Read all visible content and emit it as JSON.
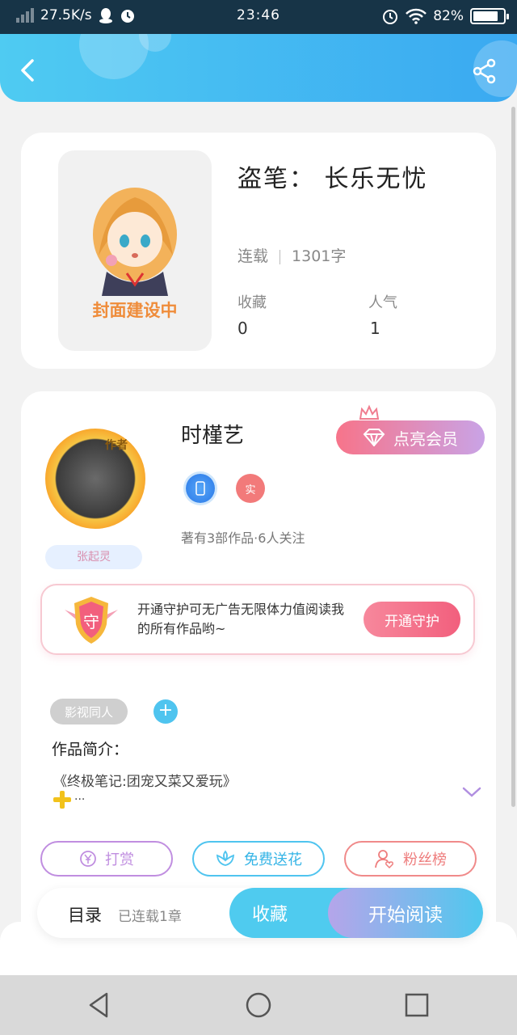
{
  "status_bar": {
    "net_speed": "27.5K/s",
    "time": "23:46",
    "battery": "82%",
    "battery_level": 0.82,
    "icons": [
      "signal-icon",
      "qq-icon",
      "alarm-icon",
      "wifi-icon",
      "battery-icon"
    ]
  },
  "header": {
    "back_icon": "back-icon",
    "share_icon": "share-icon",
    "background_colors": [
      "#4fcbf2",
      "#3aa9f1"
    ]
  },
  "book": {
    "cover_text": "封面建设中",
    "title": "盗笔： 长乐无忧",
    "status": "连载",
    "word_count": "1301字",
    "favorites_label": "收藏",
    "favorites_value": "0",
    "popularity_label": "人气",
    "popularity_value": "1"
  },
  "author": {
    "avatar_tag": "作者",
    "sign_plate": "张起灵",
    "name": "时槿艺",
    "vip_button": "点亮会员",
    "badge_real": "实",
    "stats": "著有3部作品·6人关注"
  },
  "guard": {
    "icon_text": "守",
    "text": "开通守护可无广告无限体力值阅读我的所有作品哟~",
    "button": "开通守护"
  },
  "work": {
    "tag": "影视同人",
    "add_tag": "+",
    "intro_label": "作品简介：",
    "intro_text": "《终极笔记:团宠又菜又爱玩》",
    "intro_more": "···"
  },
  "actions": {
    "reward": "打赏",
    "flower": "免费送花",
    "fans": "粉丝榜",
    "accent_colors": {
      "reward": "#c08ee0",
      "flower": "#4fc4ef",
      "fans": "#f08a8a"
    }
  },
  "bottom_bar": {
    "toc_label": "目录",
    "toc_count": "已连载1章",
    "collect_button": "收藏",
    "read_button": "开始阅读"
  },
  "nav_bar": {
    "icons": [
      "nav-back-icon",
      "nav-home-icon",
      "nav-recents-icon"
    ]
  }
}
